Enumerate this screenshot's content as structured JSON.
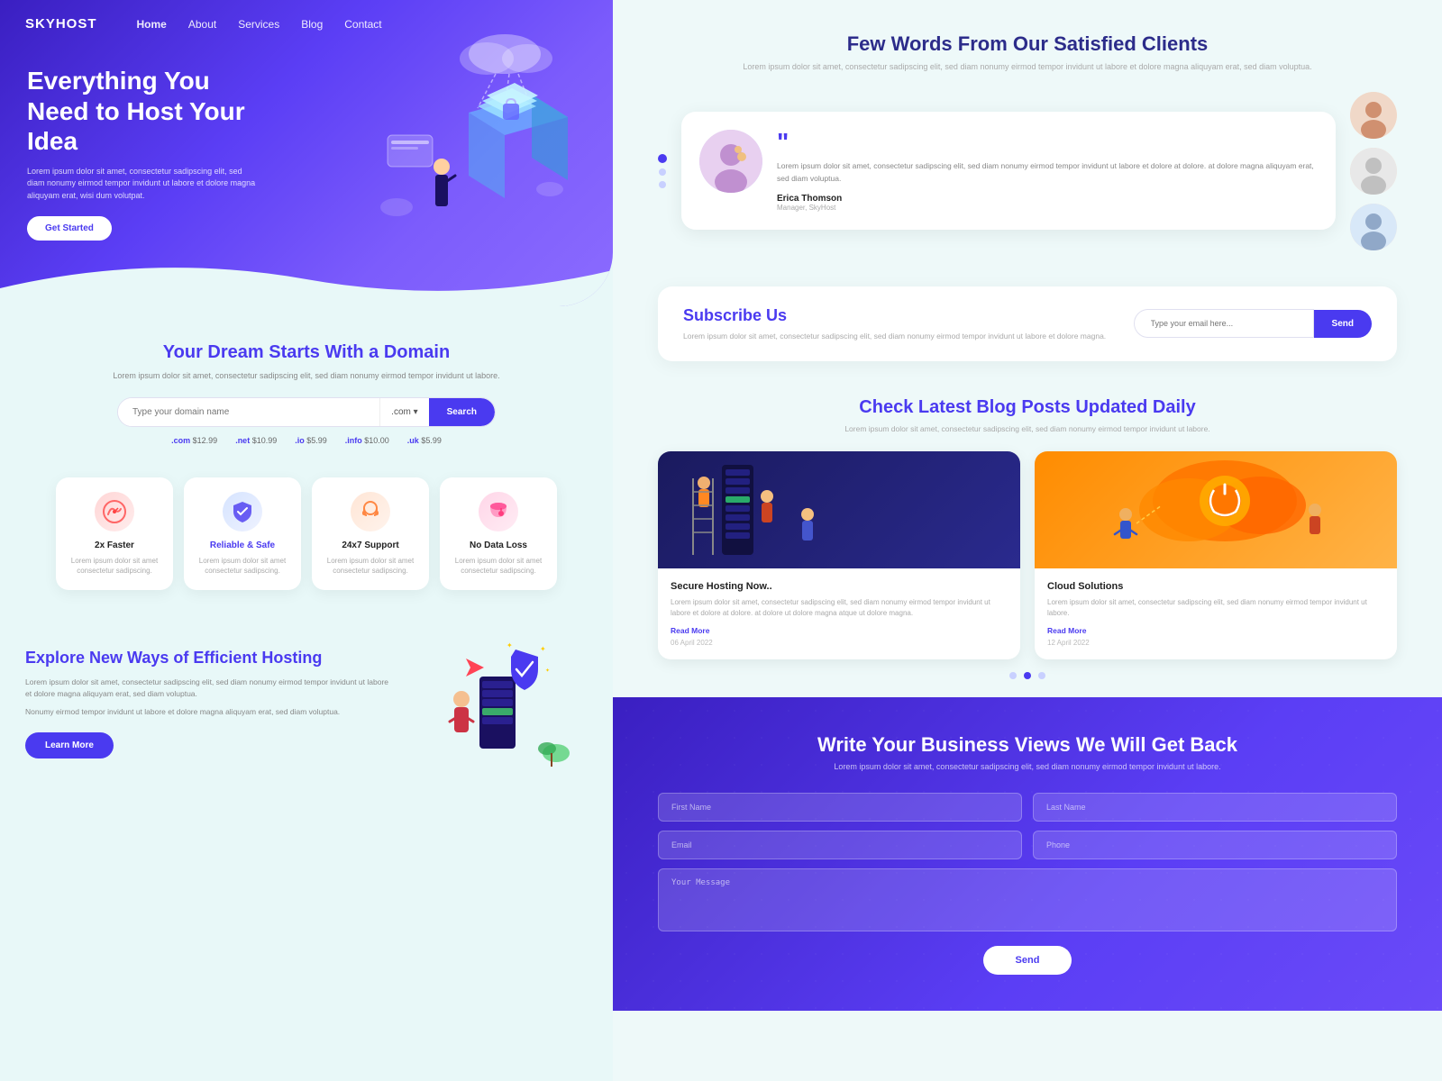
{
  "brand": {
    "logo": "SKYHOST"
  },
  "nav": {
    "links": [
      "Home",
      "About",
      "Services",
      "Blog",
      "Contact"
    ]
  },
  "hero": {
    "title": "Everything You Need to Host Your Idea",
    "description": "Lorem ipsum dolor sit amet, consectetur sadipscing elit, sed diam nonumy eirmod tempor invidunt ut labore et dolore magna aliquyam erat, wisi dum volutpat.",
    "cta": "Get Started"
  },
  "domain": {
    "title": "Your Dream Starts With a Domain",
    "description": "Lorem ipsum dolor sit amet, consectetur sadipscing elit, sed diam nonumy eirmod tempor invidunt ut labore.",
    "placeholder": "Type your domain name",
    "ext_label": ".com ▾",
    "search_btn": "Search",
    "prices": [
      {
        "ext": ".com",
        "price": "$12.99"
      },
      {
        "ext": ".net",
        "price": "$10.99"
      },
      {
        "ext": ".io",
        "price": "$5.99"
      },
      {
        "ext": ".info",
        "price": "$10.00"
      },
      {
        "ext": ".uk",
        "price": "$5.99"
      }
    ]
  },
  "features": [
    {
      "icon": "⚡",
      "title": "2x Faster",
      "title_class": "",
      "description": "Lorem ipsum dolor sit amet consectetur sadipscing."
    },
    {
      "icon": "🛡",
      "title": "Reliable & Safe",
      "title_class": "blue",
      "description": "Lorem ipsum dolor sit amet consectetur sadipscing."
    },
    {
      "icon": "🎧",
      "title": "24x7 Support",
      "title_class": "",
      "description": "Lorem ipsum dolor sit amet consectetur sadipscing."
    },
    {
      "icon": "💾",
      "title": "No Data Loss",
      "title_class": "",
      "description": "Lorem ipsum dolor sit amet consectetur sadipscing."
    }
  ],
  "hosting": {
    "title": "Explore New Ways of Efficient Hosting",
    "description1": "Lorem ipsum dolor sit amet, consectetur sadipscing elit, sed diam nonumy eirmod tempor invidunt ut labore et dolore magna aliquyam erat, sed diam voluptua.",
    "description2": "Nonumy eirmod tempor invidunt ut labore et dolore magna aliquyam erat, sed diam voluptua.",
    "cta": "Learn More"
  },
  "testimonials": {
    "section_title": "Few Words From Our Satisfied Clients",
    "section_desc": "Lorem ipsum dolor sit amet, consectetur sadipscing elit, sed diam nonumy eirmod tempor invidunt ut labore et dolore magna aliquyam erat, sed diam voluptua.",
    "current": {
      "text": "Lorem ipsum dolor sit amet, consectetur sadipscing elit, sed diam nonumy eirmod tempor invidunt ut labore et dolore at dolore. at dolore magna aliquyam erat, sed diam voluptua.",
      "name": "Erica Thomson",
      "role": "Manager, SkyHost"
    }
  },
  "subscribe": {
    "title": "Subscribe Us",
    "description": "Lorem ipsum dolor sit amet, consectetur sadipscing elit, sed diam nonumy eirmod tempor invidunt ut labore et dolore magna.",
    "placeholder": "Type your email here...",
    "btn": "Send"
  },
  "blog": {
    "title": "Check Latest Blog Posts Updated Daily",
    "description": "Lorem ipsum dolor sit amet, consectetur sadipscing elit, sed diam nonumy eirmod tempor invidunt ut labore.",
    "posts": [
      {
        "title": "Secure Hosting Now..",
        "text": "Lorem ipsum dolor sit amet, consectetur sadipscing elit, sed diam nonumy eirmod tempor invidunt ut labore et dolore at dolore. at dolore ut dolore magna atque ut dolore magna.",
        "link": "Read More",
        "date": "06 April 2022",
        "img_type": "blue"
      },
      {
        "title": "Cloud Solutions",
        "text": "Lorem ipsum dolor sit amet, consectetur sadipscing elit, sed diam nonumy eirmod tempor invidunt ut labore.",
        "link": "Read More",
        "date": "12 April 2022",
        "img_type": "orange"
      }
    ]
  },
  "contact": {
    "title": "Write Your Business Views We Will Get Back",
    "description": "Lorem ipsum dolor sit amet, consectetur sadipscing elit, sed diam nonumy eirmod tempor invidunt ut labore.",
    "fields": {
      "first_name": "First Name",
      "last_name": "Last Name",
      "email": "Email",
      "phone": "Phone",
      "message": "Your Message"
    },
    "submit": "Send"
  }
}
